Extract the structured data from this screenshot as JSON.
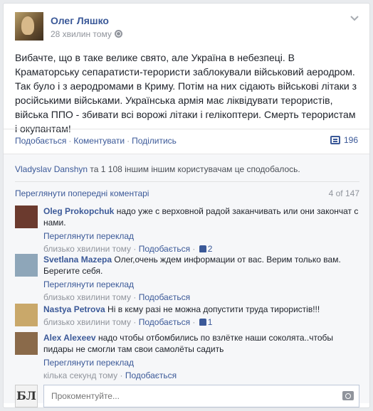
{
  "post": {
    "author": "Олег Ляшко",
    "time": "28 хвилин тому",
    "text": "Вибачте, що в таке велике свято, але Україна в небезпеці. В Краматорську сепаратисти-терористи заблокували військовий аеродром. Так було і з аеродромами в Криму. Потім на них сідають військові літаки з російськими військами. Українська армія має ліквідувати терористів, війська ППО - збивати всі ворожі літаки і гелікоптери. Смерть терористам і окупантам!",
    "icons": {
      "privacy": "globe-icon",
      "menu": "chevron-down-icon",
      "share": "comment-icon"
    }
  },
  "actions": {
    "like": "Подобається",
    "comment": "Коментувати",
    "share": "Поділитись",
    "share_count": "196"
  },
  "likes": {
    "name": "Vladyslav Danshyn",
    "rest": " та 1 108 іншим іншим користувачам це сподобалось."
  },
  "comments_header": {
    "prev": "Переглянути попередні коментарі",
    "pager": "4 of 147"
  },
  "comments": [
    {
      "name": "Oleg Prokopchuk",
      "text": " надо уже с верховной радой заканчивать или они закончат с нами.",
      "translate": "Переглянути переклад",
      "time": "близько хвилини тому",
      "like": "Подобається",
      "likes": "2",
      "avatar_color": "#6b3a2e"
    },
    {
      "name": "Svetlana Mazepa",
      "text": " Олег,очень ждем информации от вас. Верим только вам. Берегите себя.",
      "translate": "Переглянути переклад",
      "time": "близько хвилини тому",
      "like": "Подобається",
      "likes": "",
      "avatar_color": "#8ea6b9"
    },
    {
      "name": "Nastya Petrova",
      "text": " Ні в кєму разі не можна допустити труда тирористів!!!",
      "translate": "",
      "time": "близько хвилини тому",
      "like": "Подобається",
      "likes": "1",
      "avatar_color": "#c9a86a"
    },
    {
      "name": "Alex Alexeev",
      "text": " надо чтобы отбомбились по взлётке наши соколята..чтобы пидары не смогли там свои самолёты садить",
      "translate": "Переглянути переклад",
      "time": "кілька секунд тому",
      "like": "Подобається",
      "likes": "",
      "avatar_color": "#8a6a4a"
    }
  ],
  "composer": {
    "avatar_text": "БЛ",
    "placeholder": "Прокоментуйте...",
    "camera": "camera-icon"
  }
}
